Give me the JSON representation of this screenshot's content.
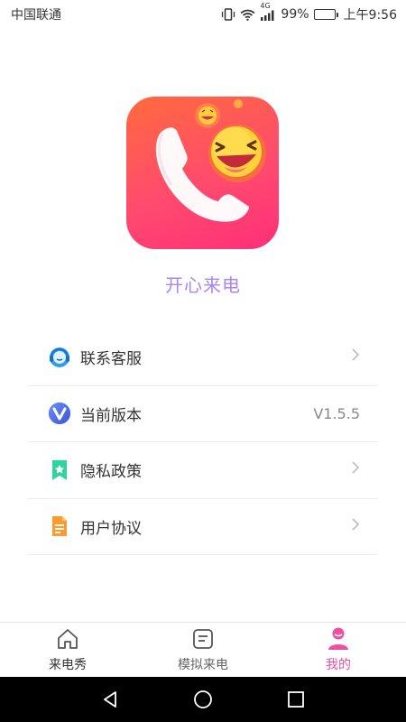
{
  "status_bar": {
    "carrier": "中国联通",
    "network": "4G",
    "battery_percent": "99%",
    "time": "上午9:56",
    "battery_level": 0.99
  },
  "app": {
    "name": "开心来电",
    "logo_icon": "phone-laughing-emoji-icon"
  },
  "menu": [
    {
      "label": "联系客服",
      "icon": "customer-service-icon",
      "value": "",
      "chevron": true
    },
    {
      "label": "当前版本",
      "icon": "version-v-icon",
      "value": "V1.5.5",
      "chevron": false
    },
    {
      "label": "隐私政策",
      "icon": "privacy-bookmark-icon",
      "value": "",
      "chevron": true
    },
    {
      "label": "用户协议",
      "icon": "agreement-document-icon",
      "value": "",
      "chevron": true
    }
  ],
  "tabs": [
    {
      "label": "来电秀",
      "icon": "home-icon",
      "active": false
    },
    {
      "label": "模拟来电",
      "icon": "message-square-icon",
      "active": false
    },
    {
      "label": "我的",
      "icon": "profile-icon",
      "active": true
    }
  ],
  "colors": {
    "accent": "#ee4fa0",
    "app_name": "#a986f2",
    "logo_gradient_start": "#ff6a3d",
    "logo_gradient_end": "#ff2f79"
  }
}
